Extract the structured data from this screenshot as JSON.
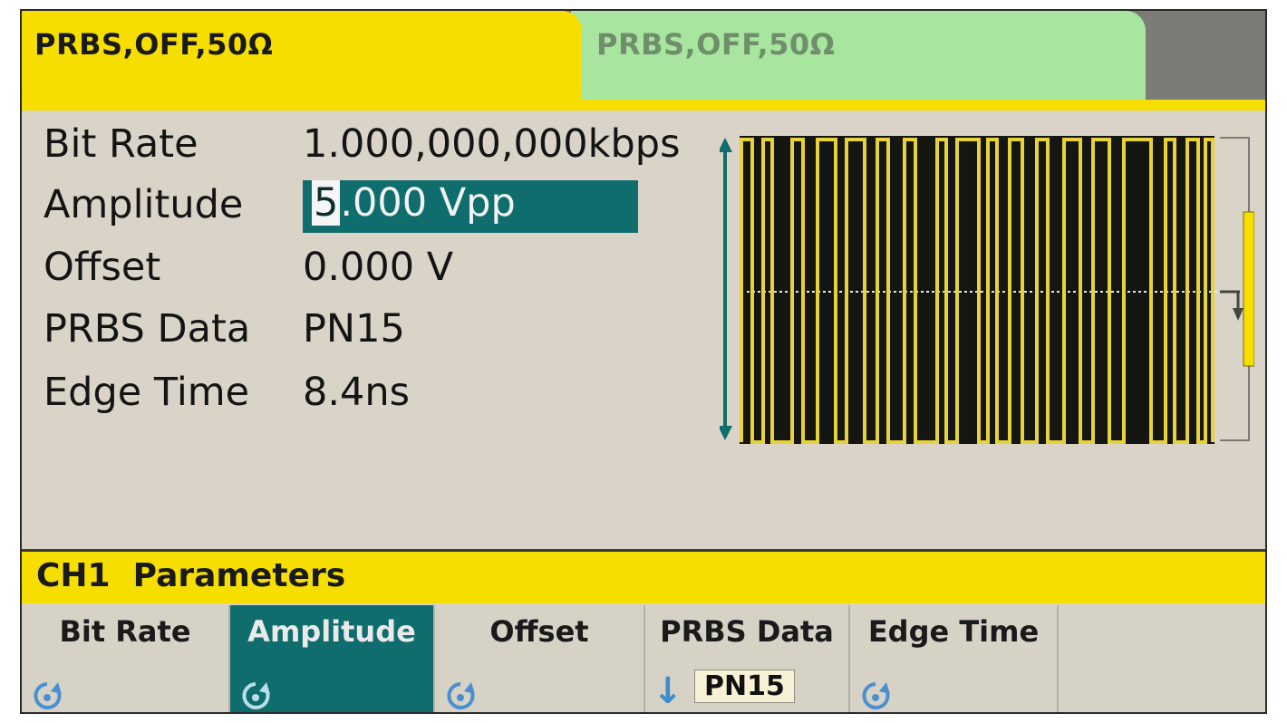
{
  "tabs": {
    "ch1": "PRBS,OFF,50Ω",
    "ch2": "PRBS,OFF,50Ω"
  },
  "params": [
    {
      "label": "Bit Rate",
      "value": "1.000,000,000kbps"
    },
    {
      "label": "Amplitude",
      "value_digit": "5",
      "value_rest": ".000 Vpp"
    },
    {
      "label": "Offset",
      "value": "0.000 V"
    },
    {
      "label": "PRBS Data",
      "value": "PN15"
    },
    {
      "label": "Edge Time",
      "value": "8.4ns"
    }
  ],
  "header": "CH1  Parameters",
  "softkeys": [
    {
      "label": "Bit Rate"
    },
    {
      "label": "Amplitude"
    },
    {
      "label": "Offset"
    },
    {
      "label": "PRBS Data",
      "value": "PN15"
    },
    {
      "label": "Edge Time"
    },
    {
      "label": ""
    }
  ],
  "colors": {
    "ch1_tab": "#f6df00",
    "ch2_tab": "#a8e6a0",
    "active_key": "#106d6d",
    "trace": "#e6d23a"
  },
  "icons": [
    "knob-icon",
    "down-arrow-icon",
    "amplitude-arrow-icon",
    "offset-arrow-icon"
  ]
}
